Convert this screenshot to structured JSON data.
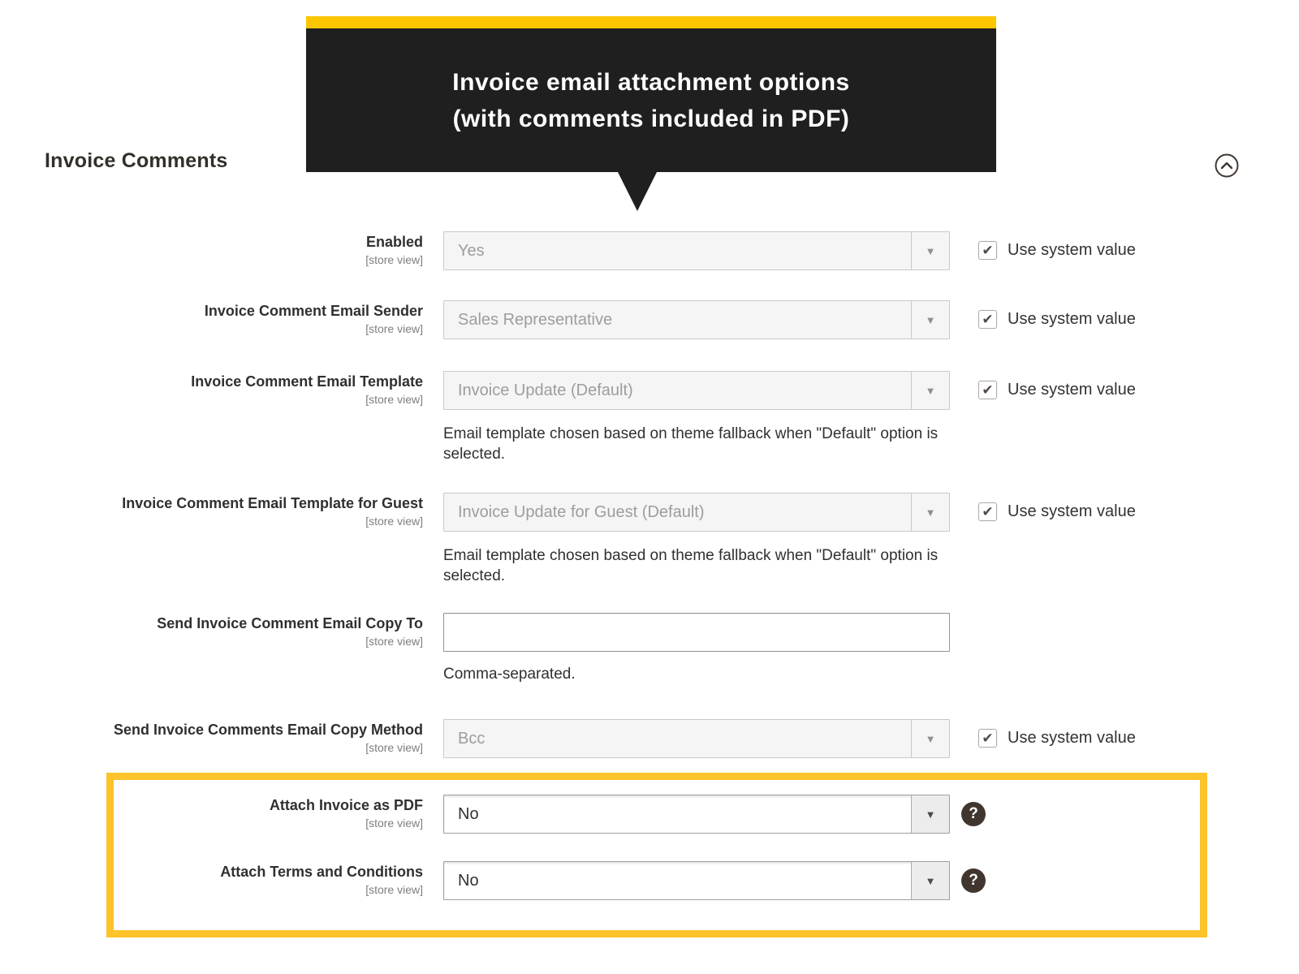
{
  "callout": {
    "line1": "Invoice email attachment options",
    "line2": "(with comments included in PDF)"
  },
  "section": {
    "title": "Invoice Comments"
  },
  "labels": {
    "use_system_value": "Use system value"
  },
  "icons": {
    "dropdown_arrow": "▼",
    "checkmark": "✔",
    "help": "?",
    "collapse": "chevron-up"
  },
  "colors": {
    "accent_yellow_bar": "#FCC600",
    "highlight_border": "#FCC32B",
    "callout_background": "#1F1F1F",
    "help_icon_background": "#41362F",
    "label_text": "#303030",
    "disabled_value_text": "#9D9D9D",
    "disabled_field_background": "#F5F5F5"
  },
  "rows": [
    {
      "label": "Enabled",
      "scope": "[store view]",
      "value": "Yes",
      "control": "select",
      "disabled": true,
      "use_system_value": true
    },
    {
      "label": "Invoice Comment Email Sender",
      "scope": "[store view]",
      "value": "Sales Representative",
      "control": "select",
      "disabled": true,
      "use_system_value": true
    },
    {
      "label": "Invoice Comment Email Template",
      "scope": "[store view]",
      "value": "Invoice Update (Default)",
      "control": "select",
      "disabled": true,
      "use_system_value": true,
      "note": "Email template chosen based on theme fallback when \"Default\" option is selected."
    },
    {
      "label": "Invoice Comment Email Template for Guest",
      "scope": "[store view]",
      "value": "Invoice Update for Guest (Default)",
      "control": "select",
      "disabled": true,
      "use_system_value": true,
      "note": "Email template chosen based on theme fallback when \"Default\" option is selected."
    },
    {
      "label": "Send Invoice Comment Email Copy To",
      "scope": "[store view]",
      "value": "",
      "control": "text",
      "disabled": false,
      "note": "Comma-separated."
    },
    {
      "label": "Send Invoice Comments Email Copy Method",
      "scope": "[store view]",
      "value": "Bcc",
      "control": "select",
      "disabled": true,
      "use_system_value": true
    },
    {
      "label": "Attach Invoice as PDF",
      "scope": "[store view]",
      "value": "No",
      "control": "select",
      "disabled": false,
      "help": true
    },
    {
      "label": "Attach Terms and Conditions",
      "scope": "[store view]",
      "value": "No",
      "control": "select",
      "disabled": false,
      "help": true
    }
  ]
}
